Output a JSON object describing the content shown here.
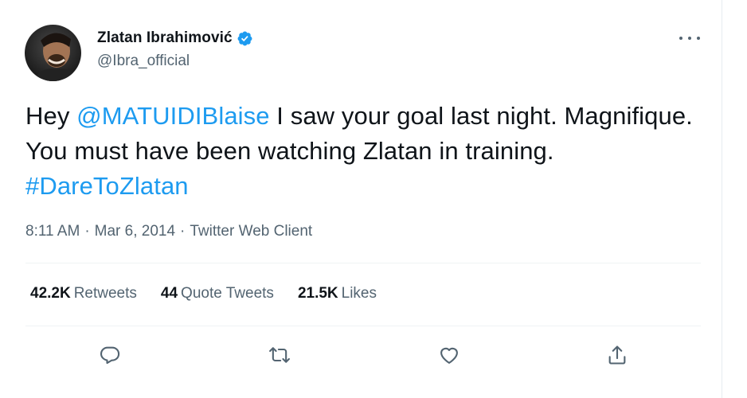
{
  "author": {
    "name": "Zlatan Ibrahimović",
    "handle": "@Ibra_official",
    "verified": true,
    "avatar_icon": "profile-photo"
  },
  "tweet": {
    "text_parts": {
      "p1": "Hey ",
      "mention": "@MATUIDIBlaise",
      "p2": " I saw your goal last night. Magnifique. You must have been watching Zlatan in training. ",
      "hashtag": "#DareToZlatan"
    },
    "time": "8:11 AM",
    "date": "Mar 6, 2014",
    "source": "Twitter Web Client",
    "separator": "·"
  },
  "stats": {
    "retweets_count": "42.2K",
    "retweets_label": "Retweets",
    "quote_count": "44",
    "quote_label": "Quote Tweets",
    "likes_count": "21.5K",
    "likes_label": "Likes"
  },
  "icons": {
    "more": "more-icon",
    "reply": "reply-icon",
    "retweet": "retweet-icon",
    "like": "like-icon",
    "share": "share-icon",
    "verified": "verified-badge-icon"
  },
  "colors": {
    "accent": "#1d9bf0",
    "text": "#0f1419",
    "secondary": "#536471",
    "divider": "#eff3f4"
  }
}
